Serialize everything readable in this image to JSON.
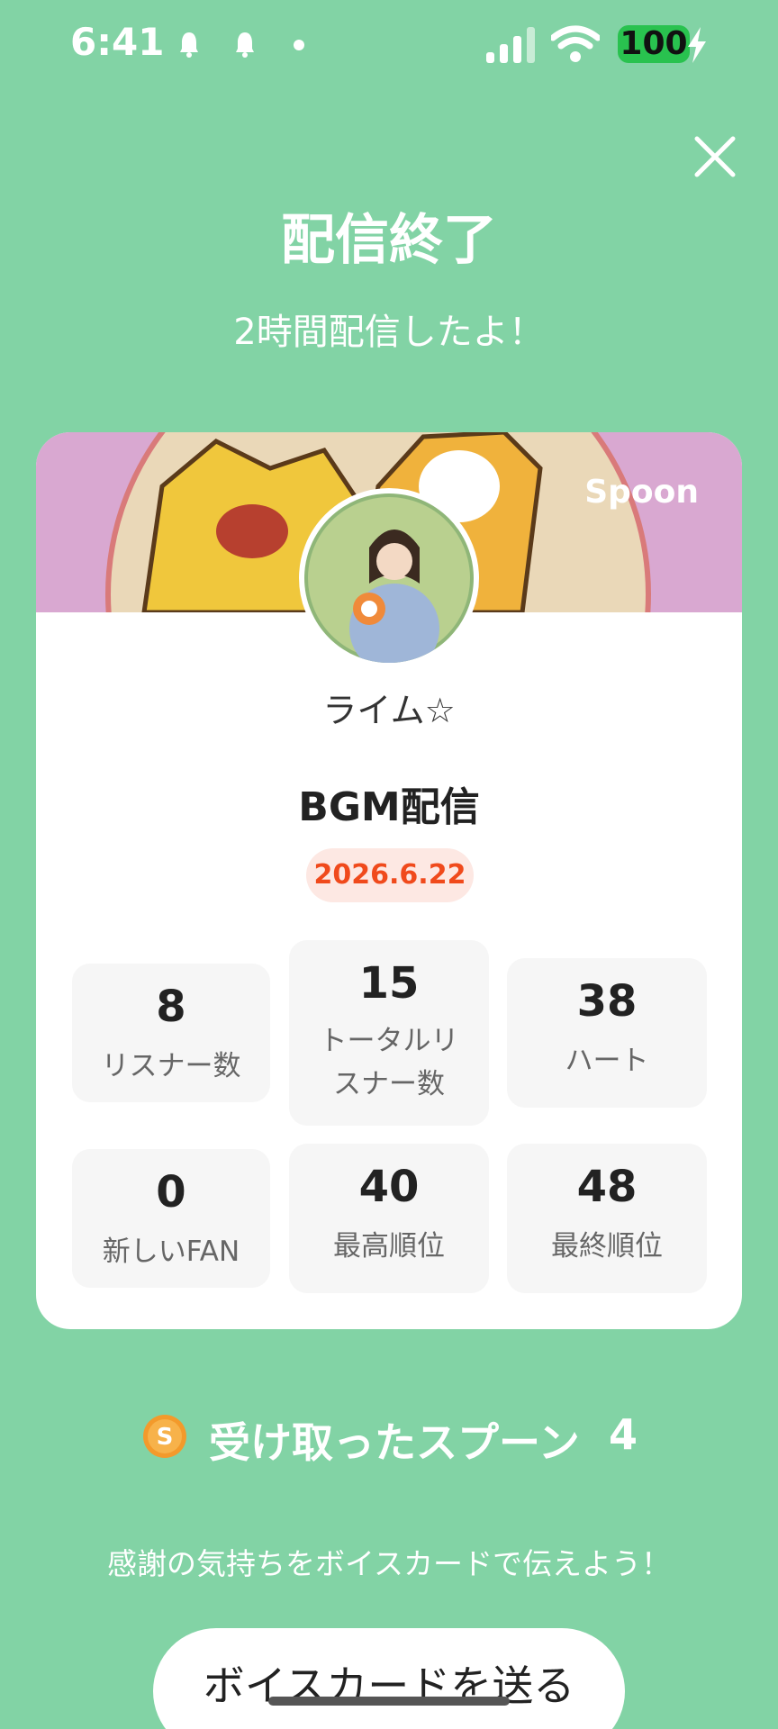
{
  "status_bar": {
    "time": "6:41",
    "battery": "100"
  },
  "header": {
    "title": "配信終了",
    "subtitle": "2時間配信したよ！"
  },
  "card": {
    "brand": "Spoon",
    "username": "ライム☆",
    "stream_title": "BGM配信",
    "date": "2026.6.22",
    "stats": [
      {
        "value": "8",
        "label": "リスナー数"
      },
      {
        "value": "15",
        "label": "トータルリスナー数"
      },
      {
        "value": "38",
        "label": "ハート"
      },
      {
        "value": "0",
        "label": "新しいFAN"
      },
      {
        "value": "40",
        "label": "最高順位"
      },
      {
        "value": "48",
        "label": "最終順位"
      }
    ]
  },
  "spoons": {
    "label": "受け取ったスプーン",
    "count": "4"
  },
  "footer": {
    "message": "感謝の気持ちをボイスカードで伝えよう！",
    "button_label": "ボイスカードを送る"
  },
  "colors": {
    "background": "#82d3a5",
    "accent": "#f04a1c",
    "battery": "#29c24f"
  },
  "icons": [
    "bell-icon",
    "signal-icon",
    "wifi-icon",
    "battery-icon",
    "close-icon",
    "spoon-coin-icon"
  ]
}
